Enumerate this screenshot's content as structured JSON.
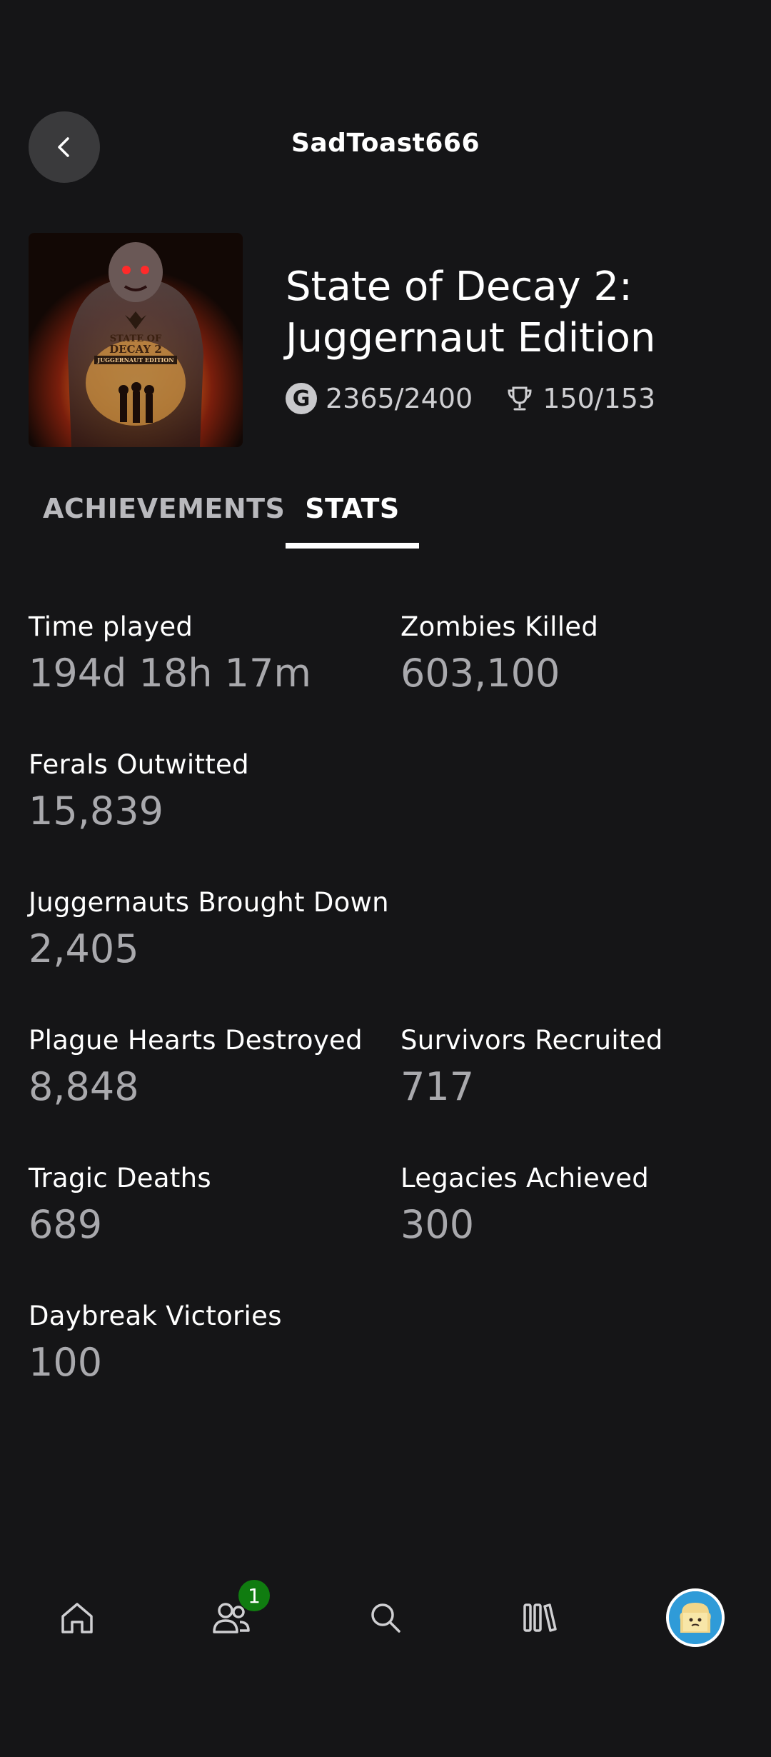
{
  "header": {
    "title": "SadToast666",
    "back_icon": "chevron-left-icon"
  },
  "game": {
    "title_line1": "State of Decay 2:",
    "title_line2": "Juggernaut Edition",
    "gamerscore": "2365/2400",
    "achievements": "150/153",
    "gamerscore_badge": "G",
    "cover_text_1": "STATE OF",
    "cover_text_2": "DECAY 2",
    "cover_text_3": "JUGGERNAUT EDITION"
  },
  "tabs": [
    {
      "label": "ACHIEVEMENTS",
      "active": false
    },
    {
      "label": "STATS",
      "active": true
    }
  ],
  "stats": [
    {
      "label": "Time played",
      "value": "194d 18h 17m"
    },
    {
      "label": "Zombies Killed",
      "value": "603,100"
    },
    {
      "label": "Ferals Outwitted",
      "value": "15,839"
    },
    {
      "label": "Juggernauts Brought Down",
      "value": "2,405"
    },
    {
      "label": "Plague Hearts Destroyed",
      "value": "8,848"
    },
    {
      "label": "Survivors Recruited",
      "value": "717"
    },
    {
      "label": "Tragic Deaths",
      "value": "689"
    },
    {
      "label": "Legacies Achieved",
      "value": "300"
    },
    {
      "label": "Daybreak Victories",
      "value": "100"
    }
  ],
  "bottom_nav": {
    "items": [
      {
        "icon": "home-icon"
      },
      {
        "icon": "people-icon",
        "badge": "1"
      },
      {
        "icon": "search-icon"
      },
      {
        "icon": "library-icon"
      },
      {
        "icon": "avatar"
      }
    ]
  },
  "colors": {
    "background": "#151517",
    "back_button": "#3a3a3c",
    "value_text": "#a9a9ad",
    "badge_green": "#107c10"
  }
}
